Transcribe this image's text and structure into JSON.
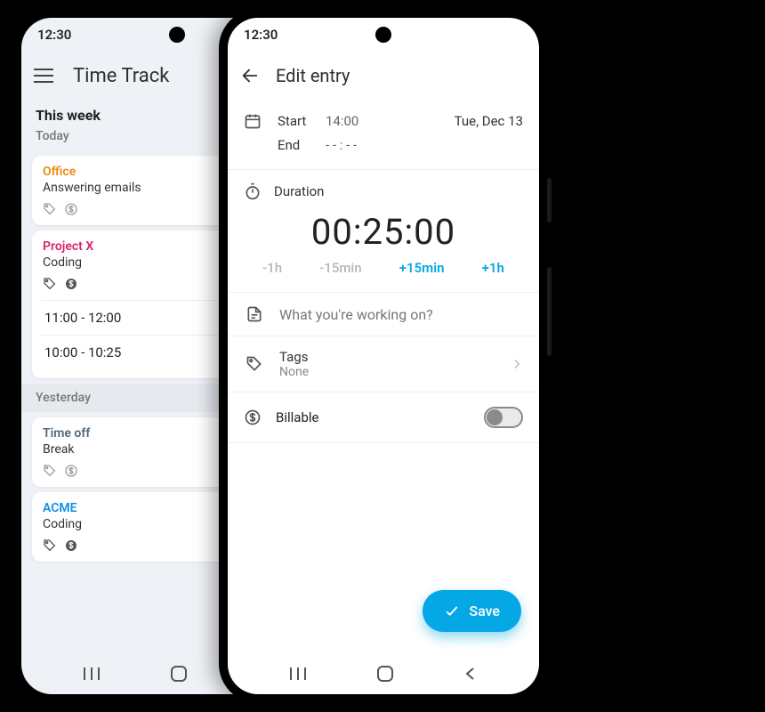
{
  "status": {
    "time": "12:30"
  },
  "left": {
    "title": "Time Track",
    "section": "This week",
    "today_label": "Today",
    "yesterday_label": "Yesterday",
    "entries": {
      "office": {
        "project": "Office",
        "task": "Answering emails"
      },
      "projectx": {
        "project": "Project X",
        "task": "Coding",
        "time1": "11:00 - 12:00",
        "time2": "10:00 - 10:25"
      },
      "timeoff": {
        "project": "Time off",
        "task": "Break"
      },
      "acme": {
        "project": "ACME",
        "task": "Coding"
      }
    }
  },
  "right": {
    "title": "Edit entry",
    "start_label": "Start",
    "start_value": "14:00",
    "date": "Tue, Dec 13",
    "end_label": "End",
    "end_value": "- - : - -",
    "duration_label": "Duration",
    "duration_value": "00:25:00",
    "adjust": {
      "m1h": "-1h",
      "m15": "-15min",
      "p15": "+15min",
      "p1h": "+1h"
    },
    "desc_placeholder": "What you're working on?",
    "tags_label": "Tags",
    "tags_value": "None",
    "billable_label": "Billable",
    "save_label": "Save"
  }
}
